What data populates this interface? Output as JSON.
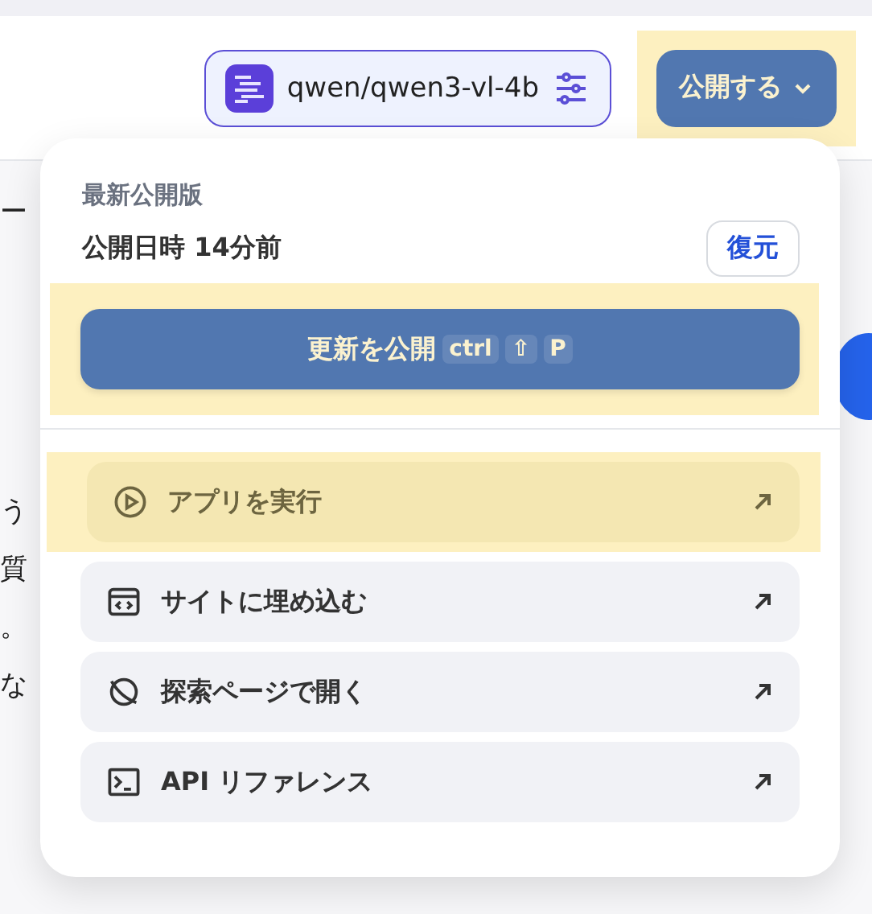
{
  "header": {
    "model": {
      "name": "qwen/qwen3-vl-4b"
    },
    "publish_button": {
      "label": "公開する",
      "highlighted": true
    }
  },
  "background_text": [
    "ー",
    "う",
    "質",
    "。",
    "な"
  ],
  "publish_menu": {
    "section_title": "最新公開版",
    "published_info": "公開日時 14分前",
    "restore_button": "復元",
    "update_button": {
      "label": "更新を公開",
      "shortcut": [
        "ctrl",
        "⇧",
        "P"
      ],
      "highlighted": true
    },
    "items": [
      {
        "kind": "play",
        "label": "アプリを実行",
        "highlighted": true
      },
      {
        "kind": "embed",
        "label": "サイトに埋め込む",
        "highlighted": false
      },
      {
        "kind": "explore",
        "label": "探索ページで開く",
        "highlighted": false
      },
      {
        "kind": "terminal",
        "label": "API リファレンス",
        "highlighted": false
      }
    ]
  }
}
